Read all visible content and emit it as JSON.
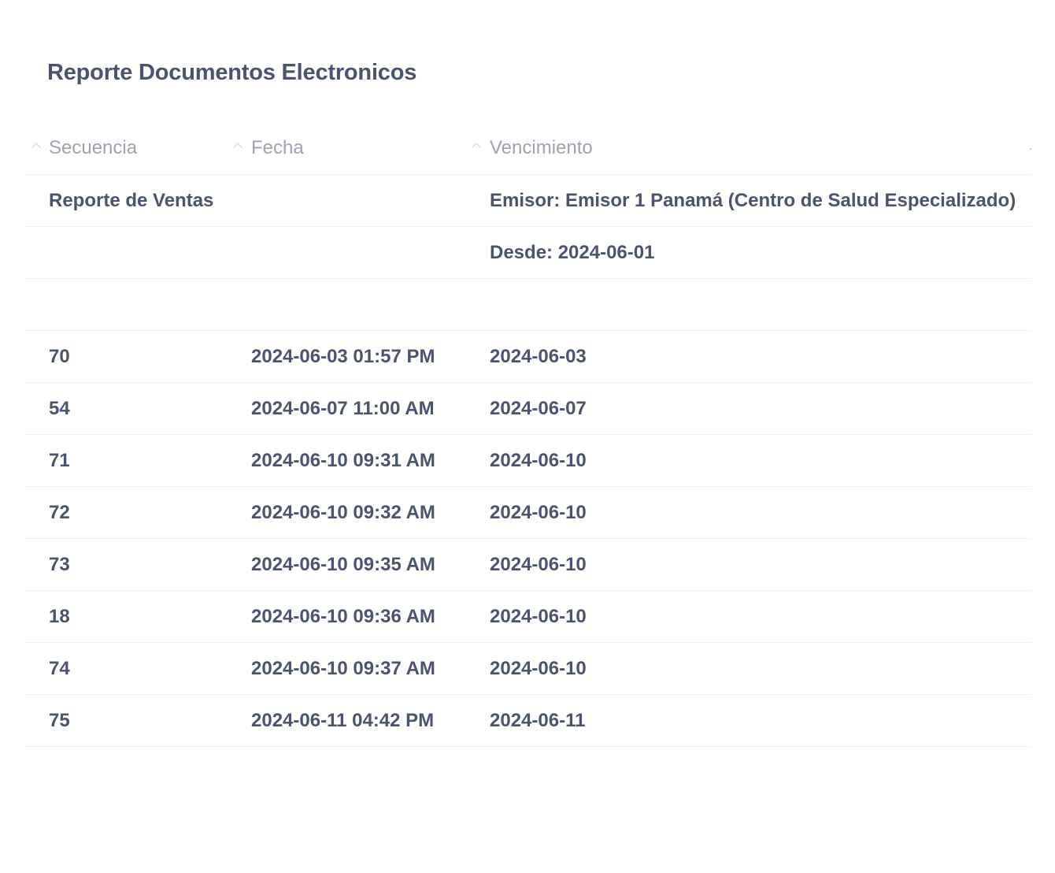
{
  "report": {
    "title": "Reporte Documentos Electronicos"
  },
  "table": {
    "columns": [
      "Secuencia",
      "Fecha",
      "Vencimiento"
    ],
    "summary": {
      "label": "Reporte de Ventas",
      "emisor": "Emisor: Emisor 1 Panamá (Centro de Salud Especializado)",
      "desde": "Desde: 2024-06-01"
    },
    "rows": [
      [
        "70",
        "2024-06-03 01:57 PM",
        "2024-06-03"
      ],
      [
        "54",
        "2024-06-07 11:00 AM",
        "2024-06-07"
      ],
      [
        "71",
        "2024-06-10 09:31 AM",
        "2024-06-10"
      ],
      [
        "72",
        "2024-06-10 09:32 AM",
        "2024-06-10"
      ],
      [
        "73",
        "2024-06-10 09:35 AM",
        "2024-06-10"
      ],
      [
        "18",
        "2024-06-10 09:36 AM",
        "2024-06-10"
      ],
      [
        "74",
        "2024-06-10 09:37 AM",
        "2024-06-10"
      ],
      [
        "75",
        "2024-06-11 04:42 PM",
        "2024-06-11"
      ]
    ]
  },
  "icons": {
    "sort": "chevron-up-icon"
  },
  "colors": {
    "text": "#4a5470",
    "header_text": "#9ea3b1",
    "divider": "#eef0f4"
  }
}
